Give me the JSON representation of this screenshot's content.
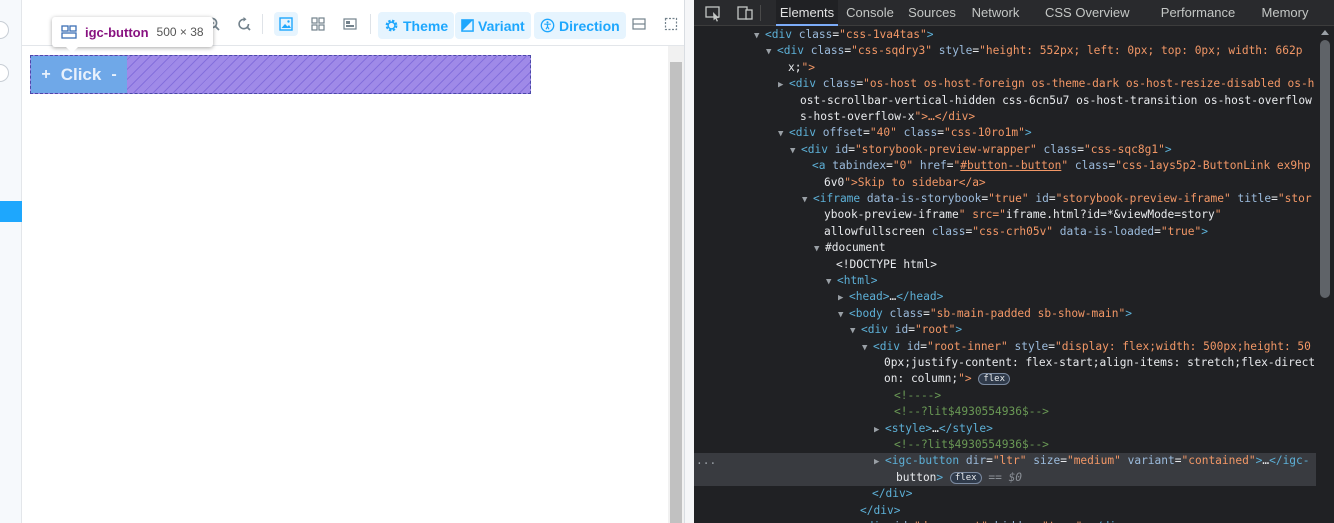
{
  "storybook": {
    "toolbar": {
      "theme_label": "Theme",
      "variant_label": "Variant",
      "direction_label": "Direction"
    },
    "tooltip": {
      "tag": "igc-button",
      "size": "500 × 38"
    },
    "preview_button": {
      "prefix_icon": "+",
      "label": "Click",
      "suffix_icon": "-"
    }
  },
  "devtools": {
    "tabs": [
      "Elements",
      "Console",
      "Sources",
      "Network",
      "CSS Overview",
      "Performance",
      "Memory"
    ],
    "active_tab": "Elements",
    "dom_lines": [
      {
        "t": "<div class=\"css-1va4tas\">"
      },
      {
        "t": "<div class=\"css-sqdry3\" style=\"height: 552px; left: 0px; top: 0px; width: 662p"
      },
      {
        "t": "x;\">"
      },
      {
        "t": "<div class=\"os-host os-host-foreign os-theme-dark os-host-resize-disabled os-h"
      },
      {
        "t": "ost-scrollbar-vertical-hidden css-6cn5u7 os-host-transition os-host-overflow o"
      },
      {
        "t": "s-host-overflow-x\">…</div>"
      },
      {
        "t": "<div offset=\"40\" class=\"css-10ro1m\">"
      },
      {
        "t": "<div id=\"storybook-preview-wrapper\" class=\"css-sqc8g1\">"
      },
      {
        "t": "<a tabindex=\"0\" href=\"#button--button\" class=\"css-1ays5p2-ButtonLink ex9hp"
      },
      {
        "t": "6v0\">Skip to sidebar</a>"
      },
      {
        "t": "<iframe data-is-storybook=\"true\" id=\"storybook-preview-iframe\" title=\"stor"
      },
      {
        "t": "ybook-preview-iframe\" src=\"iframe.html?id=*&viewMode=story\""
      },
      {
        "t": "allowfullscreen class=\"css-crh05v\" data-is-loaded=\"true\">"
      },
      {
        "t": "#document"
      },
      {
        "t": "<!DOCTYPE html>"
      },
      {
        "t": "<html>"
      },
      {
        "t": "<head>…</head>"
      },
      {
        "t": "<body class=\"sb-main-padded sb-show-main\">"
      },
      {
        "t": "<div id=\"root\">"
      },
      {
        "t": "<div id=\"root-inner\" style=\"display: flex;width: 500px;height: 50"
      },
      {
        "t": "0px;justify-content: flex-start;align-items: stretch;flex-directi"
      },
      {
        "t": "on: column;\">"
      },
      {
        "t": "<!---->"
      },
      {
        "t": "<!--?lit$4930554936$-->"
      },
      {
        "t": "<style>…</style>"
      },
      {
        "t": "<!--?lit$4930554936$-->"
      },
      {
        "t": "<igc-button dir=\"ltr\" size=\"medium\" variant=\"contained\">…</igc-"
      },
      {
        "t": "button>"
      },
      {
        "t": "</div>"
      },
      {
        "t": "</div>"
      },
      {
        "t": "<div id=\"docs-root\" hidden=\"true\"></div>"
      }
    ],
    "pills": {
      "flex": "flex"
    },
    "selected_suffix": "== $0",
    "ellipsis": "..."
  }
}
